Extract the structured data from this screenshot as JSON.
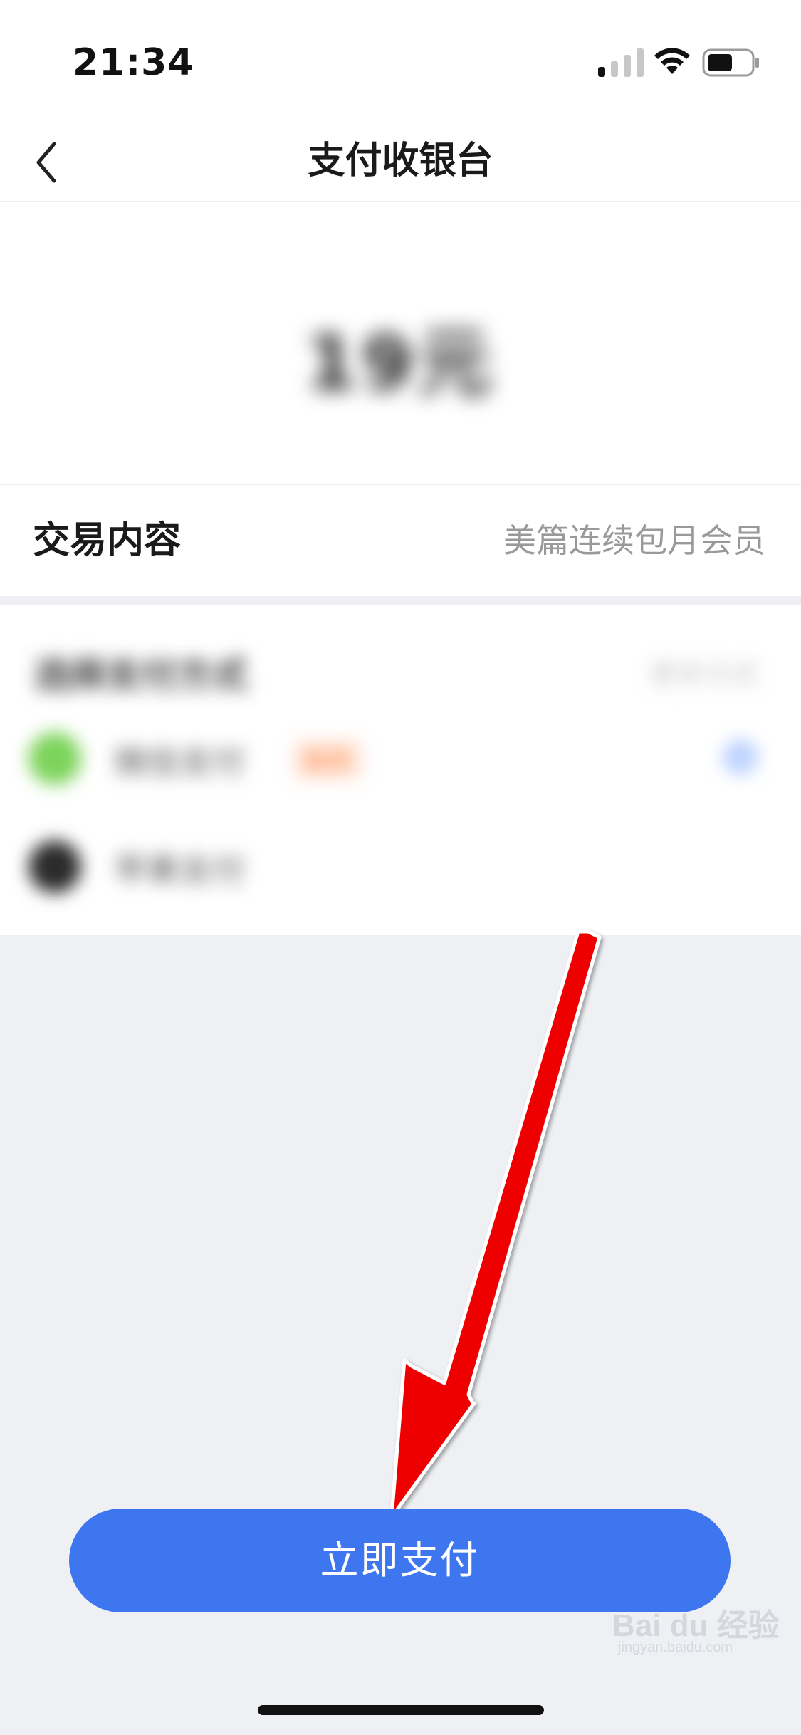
{
  "status_bar": {
    "time": "21:34",
    "signal_icon": "cellular-signal-icon",
    "wifi_icon": "wifi-icon",
    "battery_icon": "battery-icon"
  },
  "nav": {
    "back_icon": "chevron-left-icon",
    "title": "支付收银台"
  },
  "amount": {
    "value": "19元",
    "blurred": true
  },
  "trade": {
    "label": "交易内容",
    "value": "美篇连续包月会员"
  },
  "payment_methods": {
    "blurred": true,
    "title": "选择支付方式",
    "hint": "更多方式",
    "items": [
      {
        "name": "微信支付",
        "tag": "推荐",
        "icon": "wechat-pay-icon",
        "icon_color": "#7cd35a",
        "selected": true
      },
      {
        "name": "苹果支付",
        "tag": "",
        "icon": "apple-pay-icon",
        "icon_color": "#2b2b2b",
        "selected": false
      }
    ]
  },
  "pay_button": {
    "label": "立即支付",
    "color": "#3e76f0"
  },
  "annotation": {
    "type": "arrow",
    "color": "#ff0000",
    "points_to": "pay-button"
  },
  "watermark": {
    "text": "Bai du 经验",
    "sub": "jingyan.baidu.com"
  }
}
